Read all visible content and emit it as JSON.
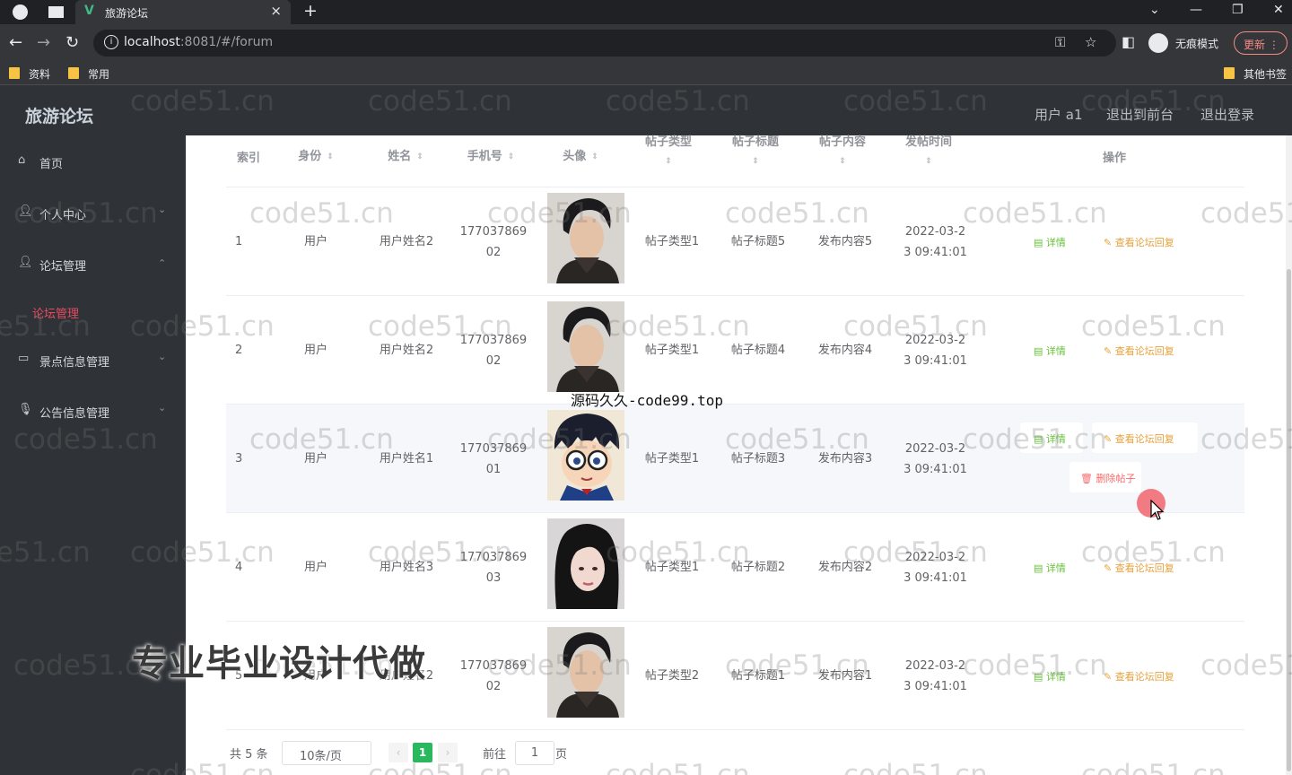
{
  "browser": {
    "tab_title": "旅游论坛",
    "tab_close": "×",
    "new_tab": "+",
    "url_host": "localhost",
    "url_rest": ":8081/#/forum",
    "profile_label": "无痕模式",
    "update_label": "更新",
    "bookmarks": [
      "资料",
      "常用"
    ],
    "other_bookmarks": "其他书签"
  },
  "header": {
    "title": "旅游论坛",
    "user": "用户 a1",
    "back_to_front": "退出到前台",
    "logout": "退出登录"
  },
  "sidebar": {
    "items": [
      {
        "label": "首页",
        "icon": "home-icon"
      },
      {
        "label": "个人中心",
        "icon": "user-icon"
      },
      {
        "label": "论坛管理",
        "icon": "user-icon"
      },
      {
        "label": "景点信息管理",
        "icon": "document-icon"
      },
      {
        "label": "公告信息管理",
        "icon": "microphone-icon"
      }
    ],
    "active_sub": "论坛管理"
  },
  "table": {
    "headers": [
      "索引",
      "身份",
      "姓名",
      "手机号",
      "头像",
      "帖子类型",
      "帖子标题",
      "帖子内容",
      "发帖时间",
      "操作"
    ],
    "rows": [
      {
        "index": "1",
        "role": "用户",
        "name": "用户姓名2",
        "phone1": "177037869",
        "phone2": "02",
        "type": "帖子类型1",
        "title": "帖子标题5",
        "content": "发布内容5",
        "time1": "2022-03-2",
        "time2": "3 09:41:01",
        "avatar": "male"
      },
      {
        "index": "2",
        "role": "用户",
        "name": "用户姓名2",
        "phone1": "177037869",
        "phone2": "02",
        "type": "帖子类型1",
        "title": "帖子标题4",
        "content": "发布内容4",
        "time1": "2022-03-2",
        "time2": "3 09:41:01",
        "avatar": "male"
      },
      {
        "index": "3",
        "role": "用户",
        "name": "用户姓名1",
        "phone1": "177037869",
        "phone2": "01",
        "type": "帖子类型1",
        "title": "帖子标题3",
        "content": "发布内容3",
        "time1": "2022-03-2",
        "time2": "3 09:41:01",
        "avatar": "cartoon"
      },
      {
        "index": "4",
        "role": "用户",
        "name": "用户姓名3",
        "phone1": "177037869",
        "phone2": "03",
        "type": "帖子类型1",
        "title": "帖子标题2",
        "content": "发布内容2",
        "time1": "2022-03-2",
        "time2": "3 09:41:01",
        "avatar": "female"
      },
      {
        "index": "5",
        "role": "用户",
        "name": "用户姓名2",
        "phone1": "177037869",
        "phone2": "02",
        "type": "帖子类型2",
        "title": "帖子标题1",
        "content": "发布内容1",
        "time1": "2022-03-2",
        "time2": "3 09:41:01",
        "avatar": "male"
      }
    ],
    "actions": {
      "detail": "详情",
      "reply": "查看论坛回复",
      "delete": "删除帖子"
    }
  },
  "pagination": {
    "total": "共 5 条",
    "page_size": "10条/页",
    "prev": "‹",
    "next": "›",
    "current": "1",
    "goto": "前往",
    "goto_value": "1",
    "page_suffix": "页"
  },
  "overlays": {
    "watermark": "code51.cn",
    "caption": "源码久久-code99.top",
    "banner": "专业毕业设计代做"
  },
  "colors": {
    "sidebar_bg": "#2f3337",
    "active_menu": "#e84a5f",
    "pager_active": "#2ab85f",
    "detail": "#67c23a",
    "reply": "#e6a23c",
    "delete": "#f56c6c"
  }
}
